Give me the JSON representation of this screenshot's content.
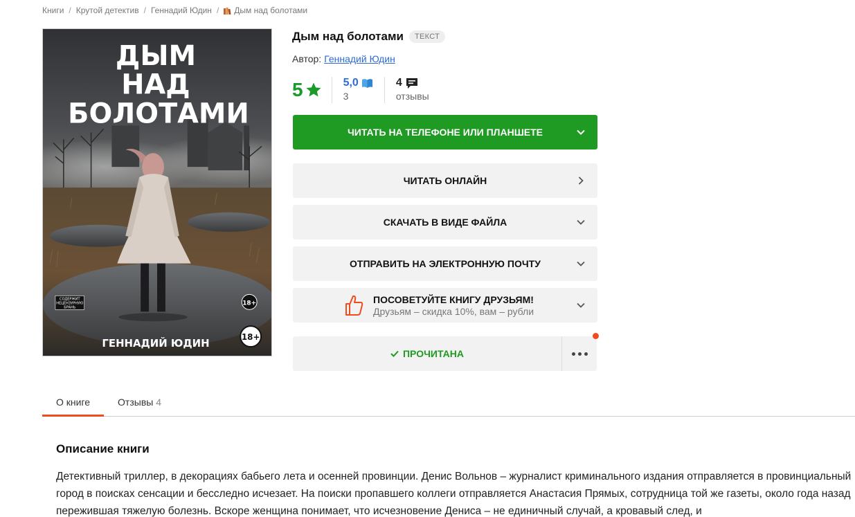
{
  "breadcrumb": {
    "items": [
      "Книги",
      "Крутой детектив",
      "Геннадий Юдин",
      "Дым над болотами"
    ]
  },
  "cover": {
    "title_lines": [
      "ДЫМ",
      "НАД",
      "БОЛОТАМИ"
    ],
    "author": "ГЕННАДИЙ ЮДИН",
    "age_badge": "18+",
    "warning_lines": [
      "СОДЕРЖИТ",
      "НЕЦЕНЗУРНУЮ",
      "БРАНЬ"
    ]
  },
  "book": {
    "title": "Дым над болотами",
    "type_badge": "ТЕКСТ",
    "author_label": "Автор:",
    "author_name": "Геннадий Юдин"
  },
  "ratings": {
    "main_value": "5",
    "lr_value": "5,0",
    "lr_count": "3",
    "reviews_count": "4",
    "reviews_label": "отзывы"
  },
  "buttons": {
    "read_phone": "ЧИТАТЬ НА ТЕЛЕФОНЕ ИЛИ ПЛАНШЕТЕ",
    "read_online": "ЧИТАТЬ ОНЛАЙН",
    "download": "СКАЧАТЬ В ВИДЕ ФАЙЛА",
    "email": "ОТПРАВИТЬ НА ЭЛЕКТРОННУЮ ПОЧТУ",
    "recommend_title": "ПОСОВЕТУЙТЕ КНИГУ ДРУЗЬЯМ!",
    "recommend_sub": "Друзьям – скидка 10%, вам – рубли",
    "read_done": "ПРОЧИТАНА"
  },
  "tabs": {
    "about": "О книге",
    "reviews": "Отзывы",
    "reviews_count": "4"
  },
  "description": {
    "title": "Описание книги",
    "text": "Детективный триллер, в декорациях бабьего лета и осенней провинции. Денис Вольнов – журналист криминального издания отправляется в провинциальный город в поисках сенсации и бесследно исчезает. На поиски пропавшего коллеги отправляется Анастасия Прямых, сотрудница той же газеты, около года назад пережившая тяжелую болезнь. Вскоре женщина понимает, что исчезновение Дениса – не единичный случай, а кровавый след, и"
  },
  "colors": {
    "accent_green": "#1f9a22",
    "rating_green": "#1a9a2b",
    "link_blue": "#2e6bd3",
    "tab_orange": "#f04b1e"
  }
}
